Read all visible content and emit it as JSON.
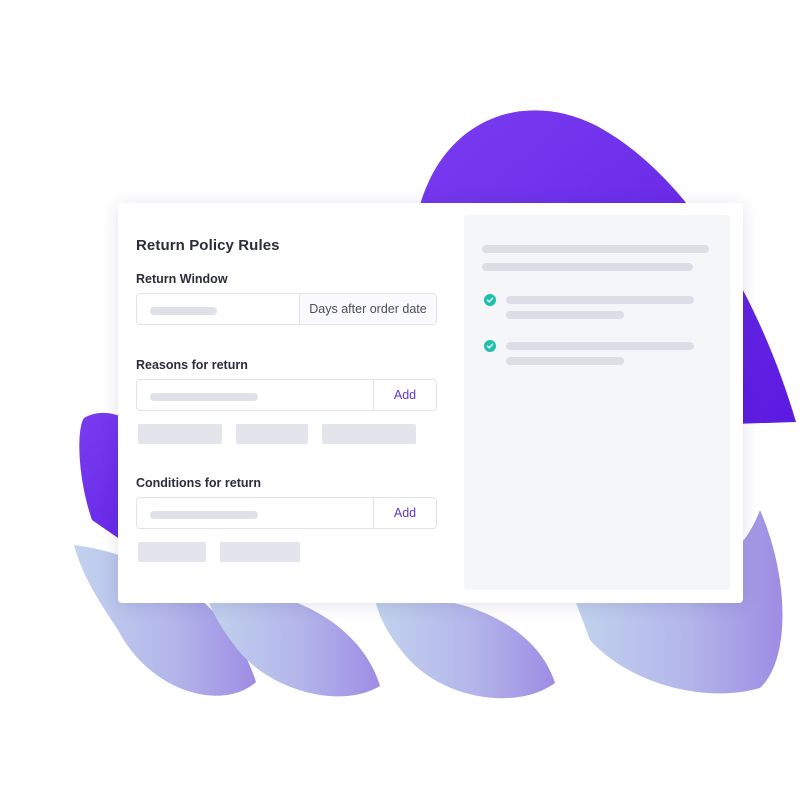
{
  "form": {
    "title": "Return Policy Rules",
    "return_window": {
      "label": "Return Window",
      "suffix": "Days after order date"
    },
    "reasons": {
      "label": "Reasons for return",
      "add_label": "Add"
    },
    "conditions": {
      "label": "Conditions for return",
      "add_label": "Add"
    }
  },
  "icons": {
    "check": "check-circle-icon"
  },
  "colors": {
    "accent": "#5b36d6",
    "check": "#1fbfb0",
    "blob_purple": "#6421e6",
    "blob_light": "#a79de6"
  }
}
